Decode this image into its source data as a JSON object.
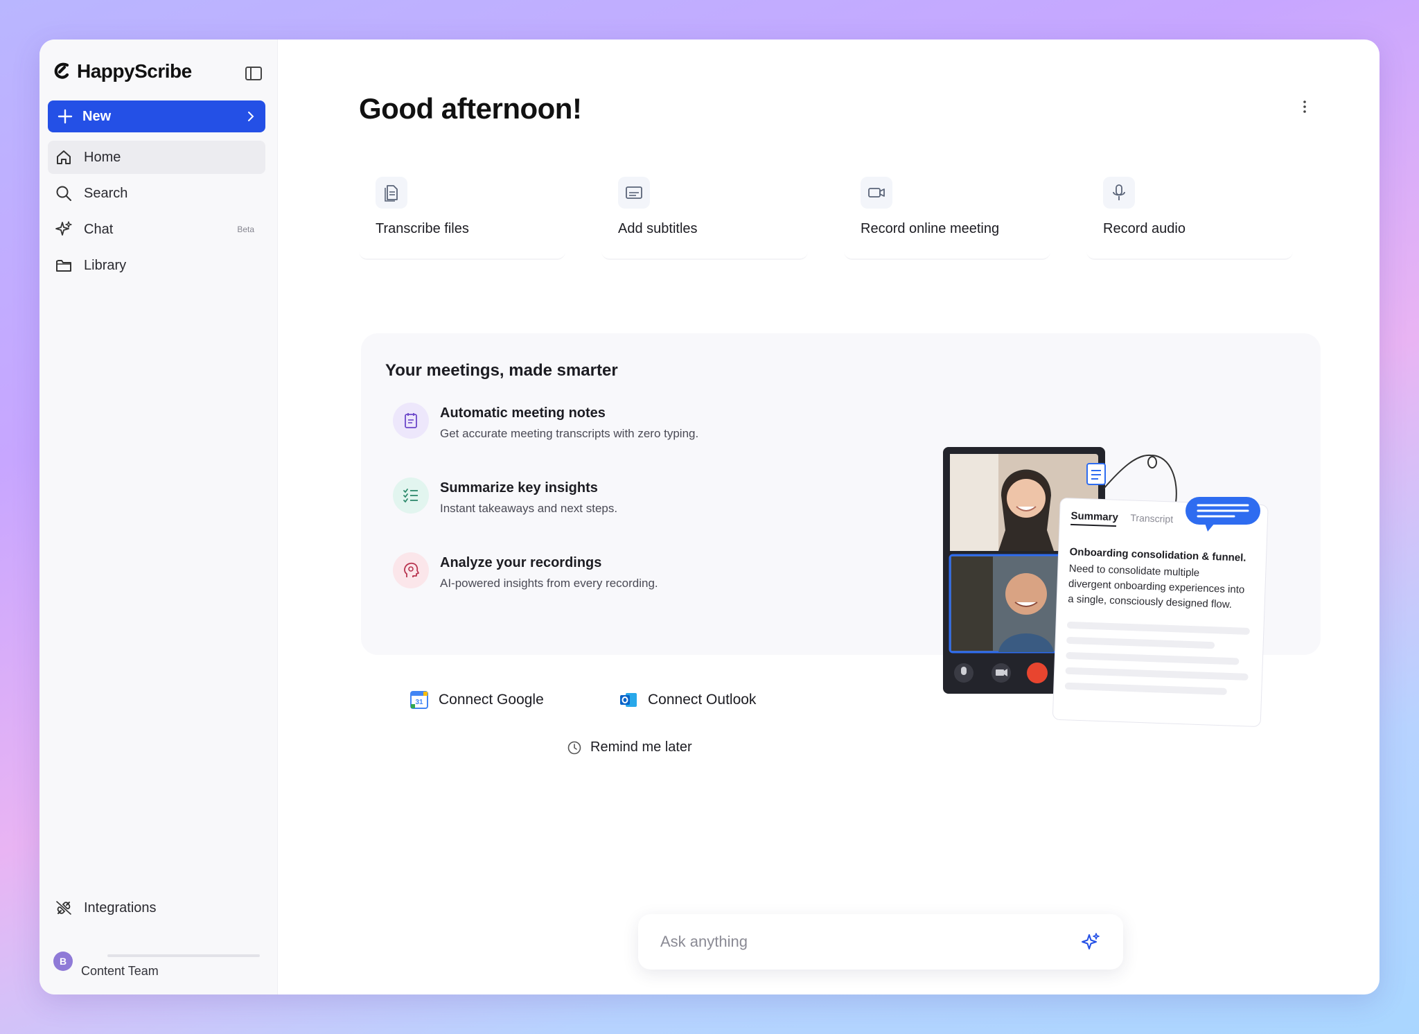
{
  "brand": {
    "name": "HappyScribe"
  },
  "sidebar": {
    "new_label": "New",
    "items": [
      {
        "label": "Home",
        "icon": "home-icon",
        "active": true
      },
      {
        "label": "Search",
        "icon": "search-icon"
      },
      {
        "label": "Chat",
        "icon": "sparkle-icon",
        "badge": "Beta"
      },
      {
        "label": "Library",
        "icon": "folder-icon"
      }
    ],
    "integrations_label": "Integrations",
    "user": {
      "initial": "B",
      "team": "Content Team"
    }
  },
  "main": {
    "greeting": "Good afternoon!",
    "actions": [
      {
        "label": "Transcribe files",
        "icon": "file-icon"
      },
      {
        "label": "Add subtitles",
        "icon": "subtitles-icon"
      },
      {
        "label": "Record online meeting",
        "icon": "video-camera-icon"
      },
      {
        "label": "Record audio",
        "icon": "microphone-icon"
      }
    ],
    "meetings": {
      "title": "Your meetings, made smarter",
      "features": [
        {
          "title": "Automatic meeting notes",
          "subtitle": "Get accurate meeting transcripts with zero typing."
        },
        {
          "title": "Summarize key insights",
          "subtitle": "Instant takeaways and next steps."
        },
        {
          "title": "Analyze your recordings",
          "subtitle": "AI-powered insights from every recording."
        }
      ],
      "connect_google": "Connect Google",
      "connect_outlook": "Connect Outlook",
      "remind_later": "Remind me later",
      "illustration": {
        "tab_summary": "Summary",
        "tab_transcript": "Transcript",
        "card_title": "Onboarding consolidation & funnel.",
        "card_text_1": "Need to consolidate multiple",
        "card_text_2": "divergent onboarding experiences into",
        "card_text_3": "a single, consciously designed flow.",
        "google_calendar_day": "31"
      }
    },
    "ask": {
      "placeholder": "Ask anything"
    }
  },
  "colors": {
    "accent": "#2450e6",
    "danger": "#e8452f",
    "avatar": "#8f7ad7"
  }
}
